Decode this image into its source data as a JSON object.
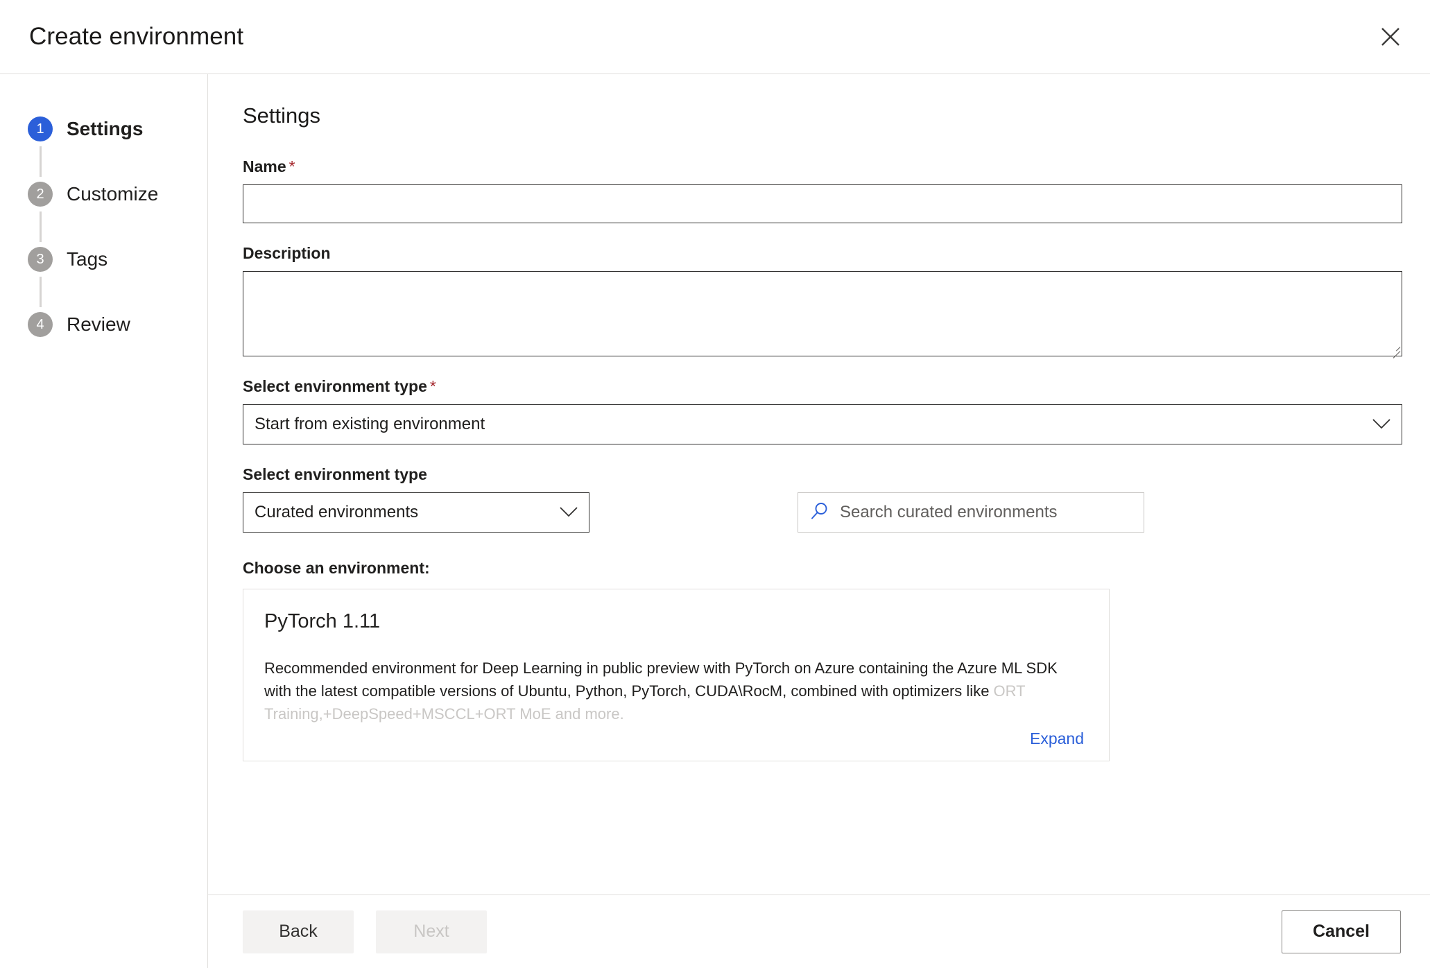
{
  "header": {
    "title": "Create environment",
    "close_icon": "close-icon"
  },
  "sidebar": {
    "steps": [
      {
        "number": "1",
        "label": "Settings",
        "state": "active"
      },
      {
        "number": "2",
        "label": "Customize",
        "state": "inactive"
      },
      {
        "number": "3",
        "label": "Tags",
        "state": "inactive"
      },
      {
        "number": "4",
        "label": "Review",
        "state": "inactive"
      }
    ]
  },
  "main": {
    "pane_title": "Settings",
    "name_field": {
      "label": "Name",
      "required_marker": "*",
      "value": "",
      "placeholder": ""
    },
    "description_field": {
      "label": "Description",
      "value": "",
      "placeholder": ""
    },
    "environment_type": {
      "label": "Select environment type",
      "required_marker": "*",
      "selected": "Start from existing environment",
      "chevron_icon": "chevron-down-icon"
    },
    "environment_source": {
      "label": "Select environment type",
      "selected": "Curated environments",
      "chevron_icon": "chevron-down-icon"
    },
    "search": {
      "placeholder": "Search curated environments",
      "value": "",
      "icon": "search-icon"
    },
    "choose_label": "Choose an environment:",
    "environment_card": {
      "title": "PyTorch 1.11",
      "description_visible": "Recommended environment for Deep Learning in public preview with PyTorch on Azure containing the Azure ML SDK with the latest compatible versions of Ubuntu, Python, PyTorch, CUDA\\RocM, combined with optimizers like ",
      "description_faded": "ORT Training,+DeepSpeed+MSCCL+ORT MoE and more.",
      "expand_label": "Expand"
    }
  },
  "footer": {
    "back_label": "Back",
    "next_label": "Next",
    "cancel_label": "Cancel"
  },
  "colors": {
    "accent_blue": "#2b5fd9",
    "required_red": "#a4262c",
    "step_inactive_gray": "#a19f9d",
    "border_dark": "#323130",
    "border_light": "#e1dfdd"
  }
}
